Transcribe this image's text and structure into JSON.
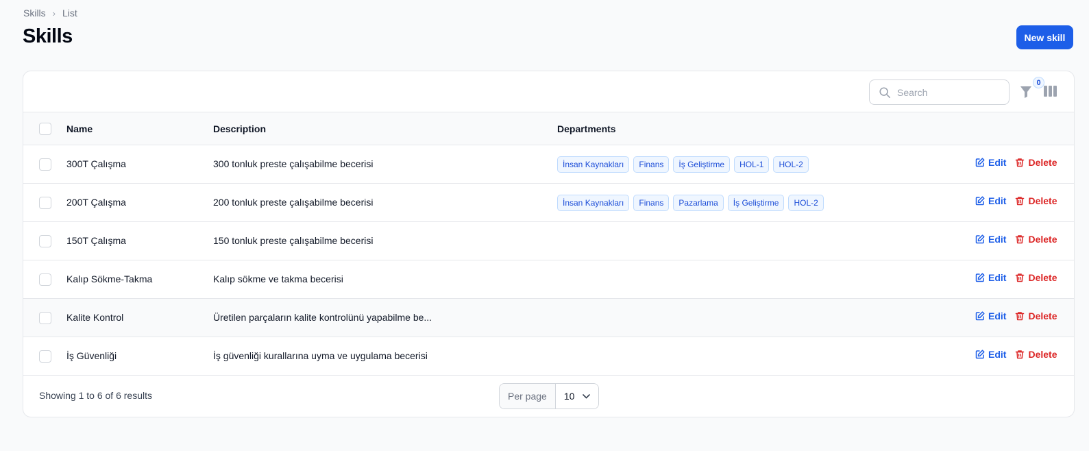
{
  "breadcrumb": {
    "root": "Skills",
    "current": "List"
  },
  "page": {
    "title": "Skills"
  },
  "actions": {
    "new_label": "New skill"
  },
  "toolbar": {
    "search_placeholder": "Search",
    "filter_count": "0"
  },
  "table": {
    "columns": {
      "name": "Name",
      "description": "Description",
      "departments": "Departments"
    },
    "edit_label": "Edit",
    "delete_label": "Delete",
    "rows": [
      {
        "name": "300T Çalışma",
        "description": "300 tonluk preste çalışabilme becerisi",
        "departments": [
          "İnsan Kaynakları",
          "Finans",
          "İş Geliştirme",
          "HOL-1",
          "HOL-2"
        ]
      },
      {
        "name": "200T Çalışma",
        "description": "200 tonluk preste çalışabilme becerisi",
        "departments": [
          "İnsan Kaynakları",
          "Finans",
          "Pazarlama",
          "İş Geliştirme",
          "HOL-2"
        ]
      },
      {
        "name": "150T Çalışma",
        "description": "150 tonluk preste çalışabilme becerisi",
        "departments": []
      },
      {
        "name": "Kalıp Sökme-Takma",
        "description": "Kalıp sökme ve takma becerisi",
        "departments": []
      },
      {
        "name": "Kalite Kontrol",
        "description": "Üretilen parçaların kalite kontrolünü yapabilme be...",
        "departments": []
      },
      {
        "name": "İş Güvenliği",
        "description": "İş güvenliği kurallarına uyma ve uygulama becerisi",
        "departments": []
      }
    ]
  },
  "footer": {
    "showing": "Showing 1 to 6 of 6 results",
    "per_page_label": "Per page",
    "per_page_value": "10"
  },
  "colors": {
    "primary": "#1d5ee8",
    "danger": "#dc2626",
    "tag_text": "#1d4ed8"
  }
}
